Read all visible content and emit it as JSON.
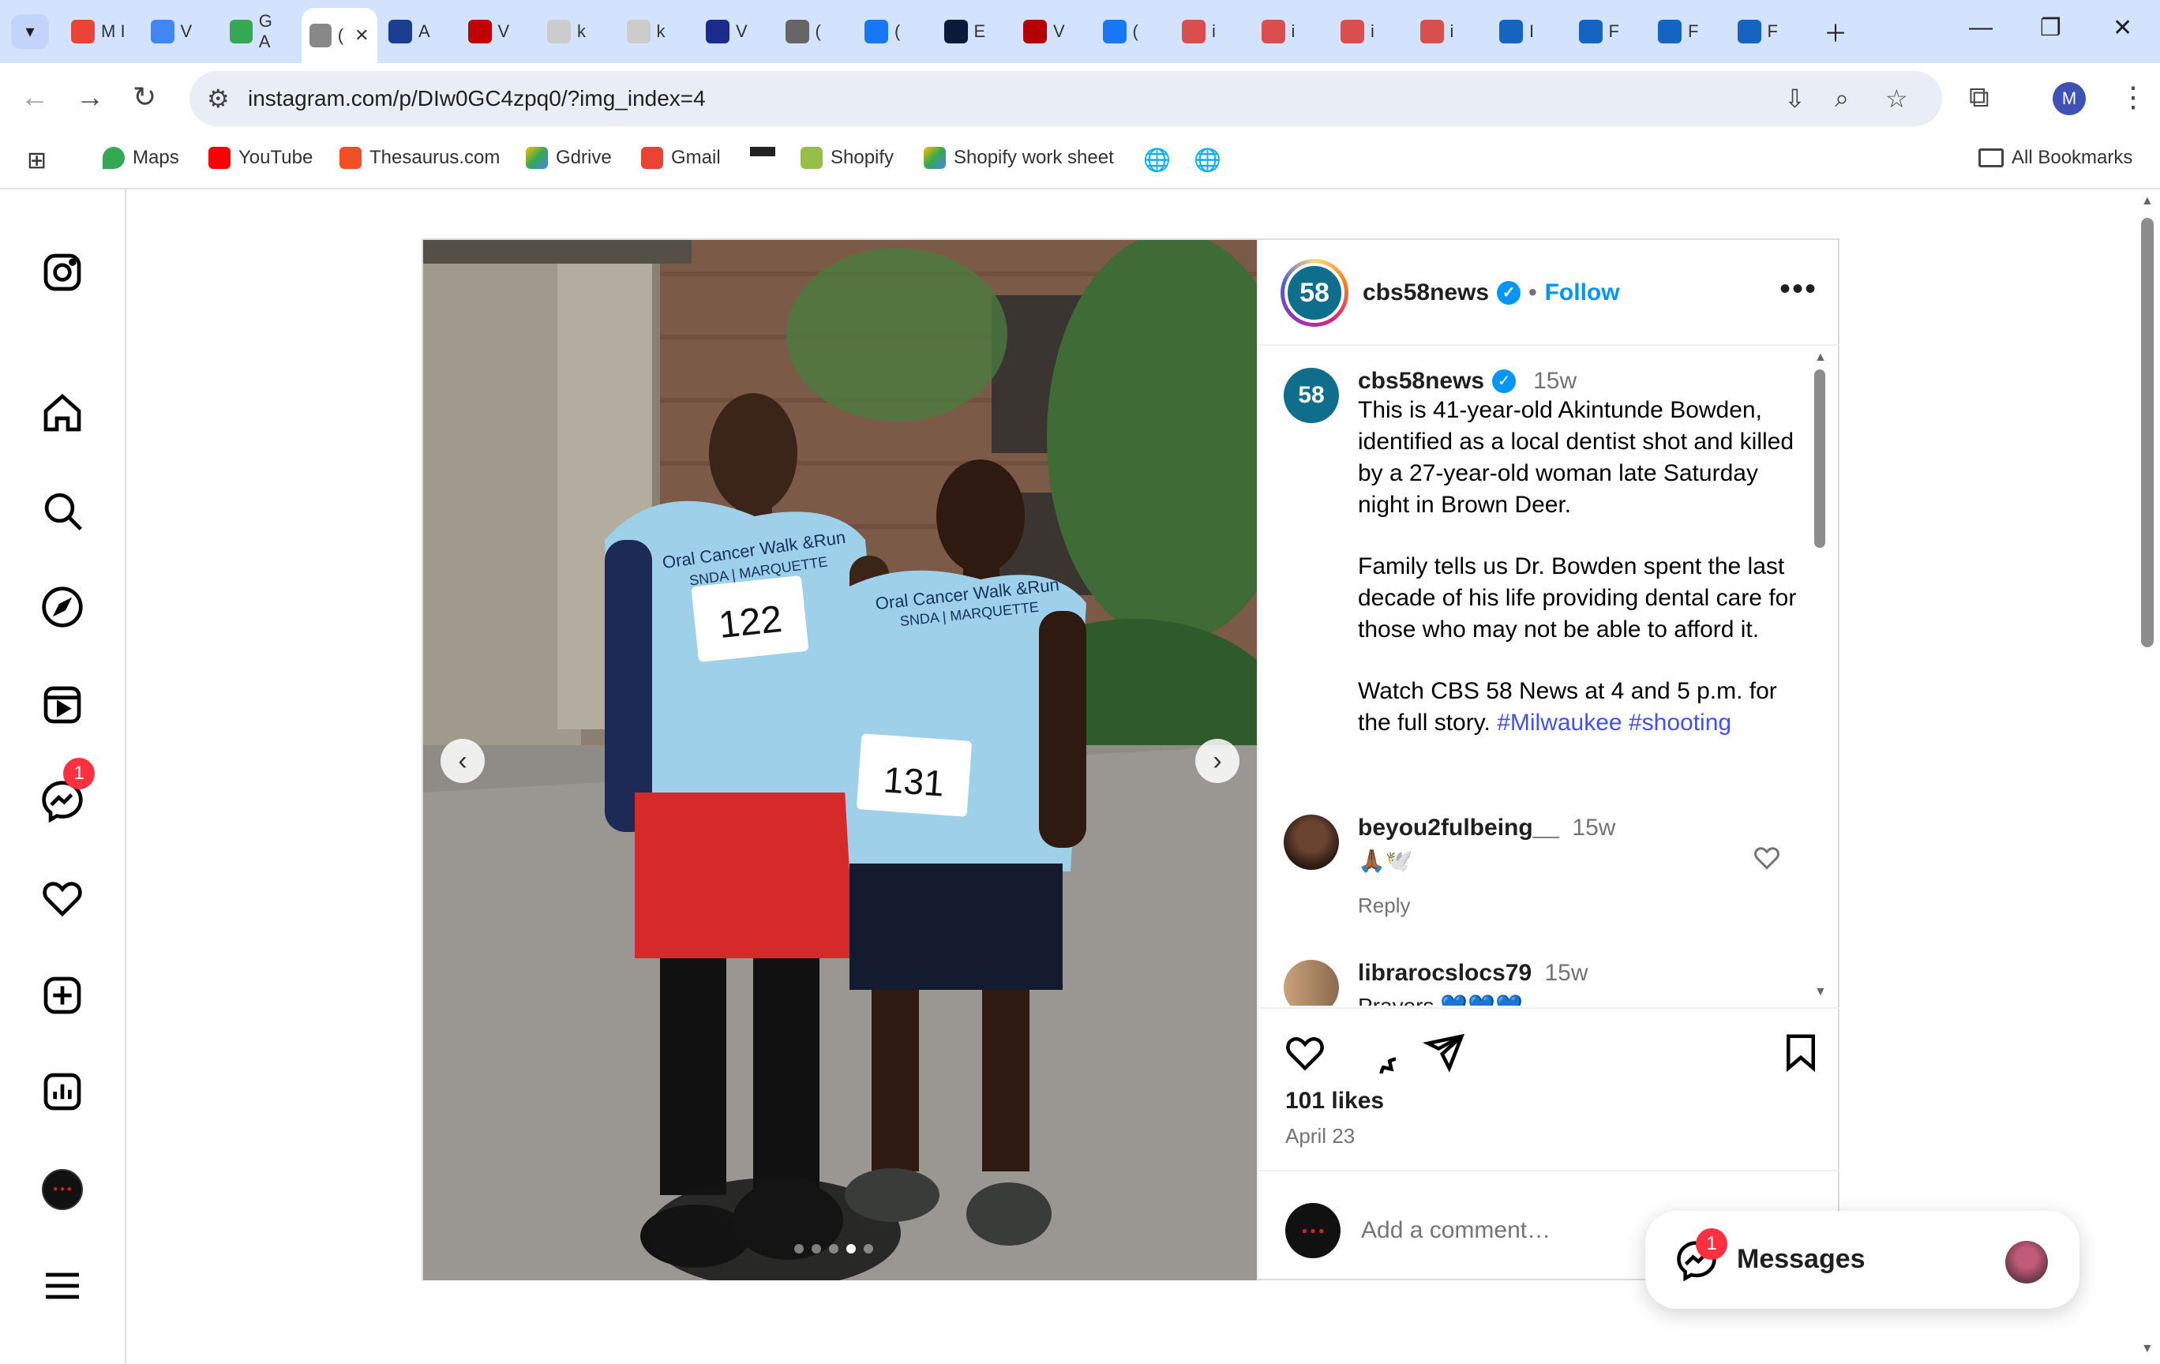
{
  "browser": {
    "tabs": [
      {
        "title": "M I",
        "color": "#ea4335"
      },
      {
        "title": "V",
        "color": "#4285f4"
      },
      {
        "title": "G A",
        "color": "#34a853"
      },
      {
        "title": "(",
        "color": "#888888"
      },
      {
        "title": "A",
        "color": "#1a3d8f"
      },
      {
        "title": "V",
        "color": "#c00000"
      },
      {
        "title": "k",
        "color": "#cccccc"
      },
      {
        "title": "k",
        "color": "#cccccc"
      },
      {
        "title": "V",
        "color": "#1a2b8c"
      },
      {
        "title": "(",
        "color": "#666666"
      },
      {
        "title": "(",
        "color": "#1877f2"
      },
      {
        "title": "E",
        "color": "#0a1a3a"
      },
      {
        "title": "V",
        "color": "#b30000"
      },
      {
        "title": "(",
        "color": "#1877f2"
      },
      {
        "title": "i",
        "color": "#d94f4f"
      },
      {
        "title": "i",
        "color": "#d94f4f"
      },
      {
        "title": "i",
        "color": "#d94f4f"
      },
      {
        "title": "i",
        "color": "#d94f4f"
      },
      {
        "title": "I",
        "color": "#1565c0"
      },
      {
        "title": "F",
        "color": "#1565c0"
      },
      {
        "title": "F",
        "color": "#1565c0"
      },
      {
        "title": "F",
        "color": "#1565c0"
      }
    ],
    "url": "instagram.com/p/DIw0GC4zpq0/?img_index=4",
    "bookmarks": [
      {
        "label": "Maps"
      },
      {
        "label": "YouTube"
      },
      {
        "label": "Thesaurus.com"
      },
      {
        "label": "Gdrive"
      },
      {
        "label": "Gmail"
      },
      {
        "label": ""
      },
      {
        "label": "Shopify"
      },
      {
        "label": "Shopify work sheet"
      }
    ],
    "all_bookmarks": "All Bookmarks",
    "profile_initial": "M"
  },
  "sidebar": {
    "messenger_badge": "1"
  },
  "post": {
    "username": "cbs58news",
    "follow": "Follow",
    "avatar_text": "58",
    "caption": {
      "username": "cbs58news",
      "age": "15w",
      "p1": "This is 41-year-old Akintunde Bowden, identified as a local dentist shot and killed by a 27-year-old woman late Saturday night in Brown Deer.",
      "p2": "Family tells us Dr. Bowden spent the last decade of his life providing dental care for those who may not be able to afford it.",
      "p3": "Watch CBS 58 News at 4 and 5 p.m. for the full story.",
      "hashtag1": "#Milwaukee",
      "hashtag2": "#shooting"
    },
    "comments": [
      {
        "user": "beyou2fulbeing__",
        "age": "15w",
        "text": "🙏🏾🕊️",
        "reply": "Reply"
      },
      {
        "user": "librarocslocs79",
        "age": "15w",
        "text": "Prayers 💙💙💙"
      }
    ],
    "likes": "101 likes",
    "date": "April 23",
    "add_comment_placeholder": "Add a comment…",
    "photo": {
      "bib1": "122",
      "bib2": "131",
      "shirt_line1": "Oral Cancer Walk &Run",
      "shirt_line2": "SNDA | MARQUETTE"
    }
  },
  "messages": {
    "label": "Messages",
    "badge": "1"
  },
  "colors": {
    "accent": "#0095f6",
    "link": "#4150f7",
    "badge": "#ff3040",
    "tabbar": "#d3e3fd"
  }
}
